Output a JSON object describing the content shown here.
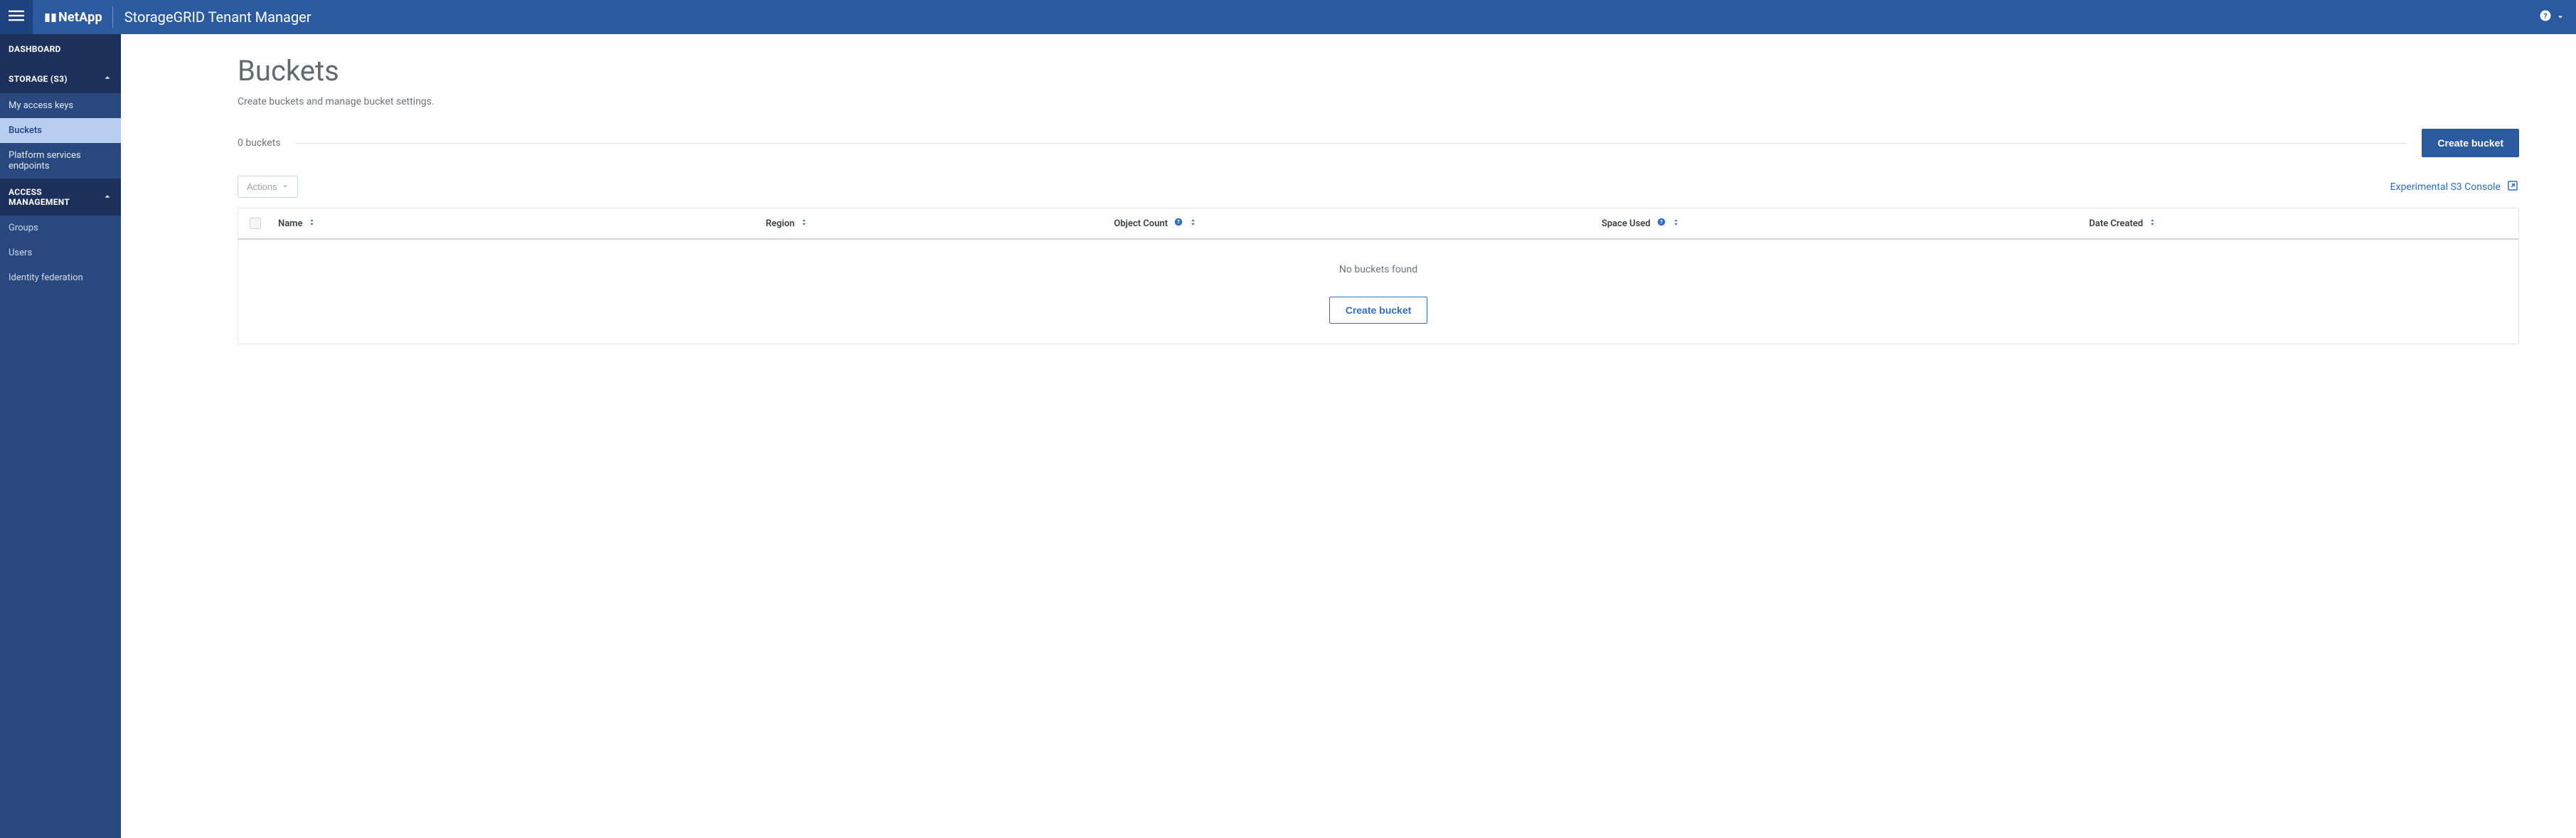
{
  "header": {
    "brand": "NetApp",
    "app_title": "StorageGRID Tenant Manager"
  },
  "sidebar": {
    "dashboard": "DASHBOARD",
    "storage_section": "STORAGE (S3)",
    "storage_items": [
      {
        "label": "My access keys"
      },
      {
        "label": "Buckets"
      },
      {
        "label": "Platform services endpoints"
      }
    ],
    "access_section": "ACCESS MANAGEMENT",
    "access_items": [
      {
        "label": "Groups"
      },
      {
        "label": "Users"
      },
      {
        "label": "Identity federation"
      }
    ]
  },
  "main": {
    "title": "Buckets",
    "subtitle": "Create buckets and manage bucket settings.",
    "count_label": "0 buckets",
    "create_button": "Create bucket",
    "actions_button": "Actions",
    "s3_console_link": "Experimental S3 Console",
    "columns": {
      "name": "Name",
      "region": "Region",
      "object_count": "Object Count",
      "space_used": "Space Used",
      "date_created": "Date Created"
    },
    "empty_message": "No buckets found",
    "empty_create_button": "Create bucket"
  }
}
